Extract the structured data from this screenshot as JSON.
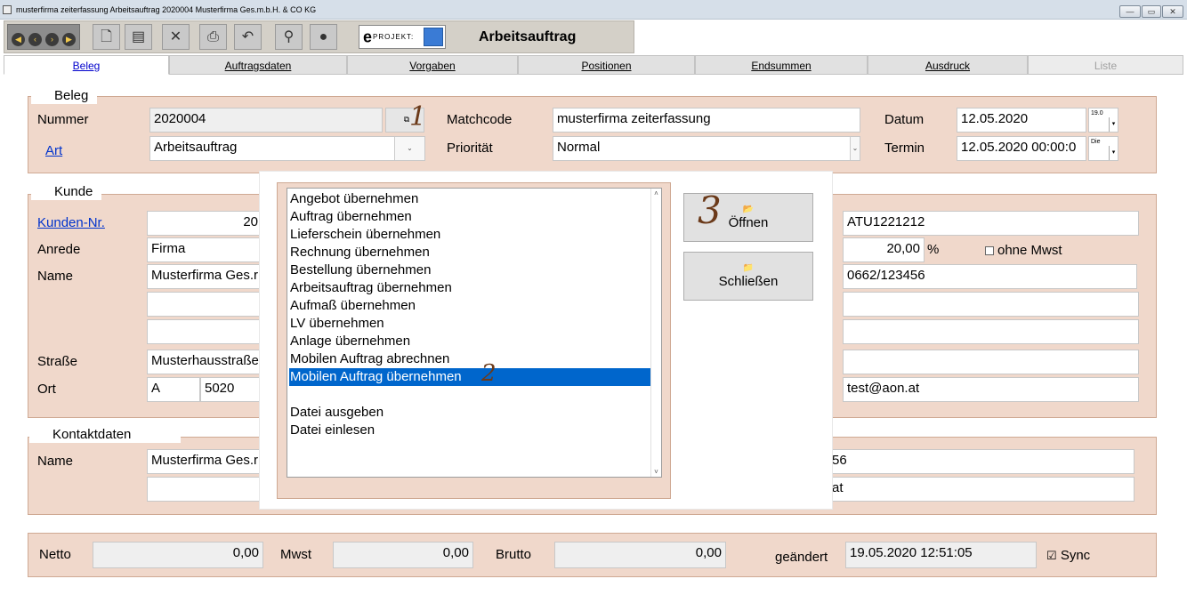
{
  "window": {
    "title": "musterfirma zeiterfassung  Arbeitsauftrag  2020004  Musterfirma Ges.m.b.H. & CO KG",
    "controls": [
      "—",
      "▭",
      "✕"
    ]
  },
  "toolbar": {
    "brand_e": "e",
    "brand_text": "PROJEKT:",
    "page_title": "Arbeitsauftrag"
  },
  "tabs": [
    {
      "label": "Beleg",
      "state": "active"
    },
    {
      "label": "Auftragsdaten",
      "state": "normal"
    },
    {
      "label": "Vorgaben",
      "state": "normal"
    },
    {
      "label": "Positionen",
      "state": "normal"
    },
    {
      "label": "Endsummen",
      "state": "normal"
    },
    {
      "label": "Ausdruck",
      "state": "normal"
    },
    {
      "label": "Liste",
      "state": "disabled"
    }
  ],
  "beleg": {
    "legend": "Beleg",
    "nummer_label": "Nummer",
    "nummer_value": "2020004",
    "art_label": "Art",
    "art_value": "Arbeitsauftrag",
    "matchcode_label": "Matchcode",
    "matchcode_value": "musterfirma zeiterfassung",
    "prioritaet_label": "Priorität",
    "prioritaet_value": "Normal",
    "datum_label": "Datum",
    "datum_value": "12.05.2020",
    "datum_spin": "19.0",
    "termin_label": "Termin",
    "termin_value": "12.05.2020 00:00:0",
    "termin_spin": "Die"
  },
  "kunde": {
    "legend": "Kunde",
    "kundennr_label": "Kunden-Nr.",
    "kundennr_value": "20",
    "anrede_label": "Anrede",
    "anrede_value": "Firma",
    "name_label": "Name",
    "name_value": "Musterfirma Ges.r",
    "strasse_label": "Straße",
    "strasse_value": "Musterhausstraße",
    "ort_label": "Ort",
    "land_value": "A",
    "plz_value": "5020",
    "uid_value": "ATU1221212",
    "mwst_value": "20,00",
    "percent": "%",
    "ohne_mwst_label": "ohne Mwst",
    "telefon_value": "0662/123456",
    "email_value": "test@aon.at"
  },
  "kontakt": {
    "legend": "Kontaktdaten",
    "name_label": "Name",
    "name_value": "Musterfirma Ges.r",
    "right1_value": "56",
    "right2_value": "at"
  },
  "summen": {
    "netto_label": "Netto",
    "netto_value": "0,00",
    "mwst_label": "Mwst",
    "mwst_value": "0,00",
    "brutto_label": "Brutto",
    "brutto_value": "0,00",
    "geaendert_label": "geändert",
    "geaendert_value": "19.05.2020 12:51:05",
    "sync_label": "Sync",
    "sync_checked": "☑"
  },
  "dialog": {
    "items": [
      "Angebot übernehmen",
      "Auftrag übernehmen",
      "Lieferschein übernehmen",
      "Rechnung übernehmen",
      "Bestellung übernehmen",
      "Arbeitsauftrag übernehmen",
      "Aufmaß übernehmen",
      "LV übernehmen",
      "Anlage übernehmen",
      "Mobilen Auftrag abrechnen",
      "Mobilen Auftrag übernehmen",
      "",
      "Datei ausgeben",
      "Datei einlesen"
    ],
    "selected_index": 10,
    "open_label": "Öffnen",
    "close_label": "Schließen"
  },
  "annotations": {
    "one": "1",
    "two": "2",
    "three": "3"
  },
  "colors": {
    "panel": "#f0d8cb",
    "selection": "#0066cc",
    "link": "#0033cc"
  }
}
